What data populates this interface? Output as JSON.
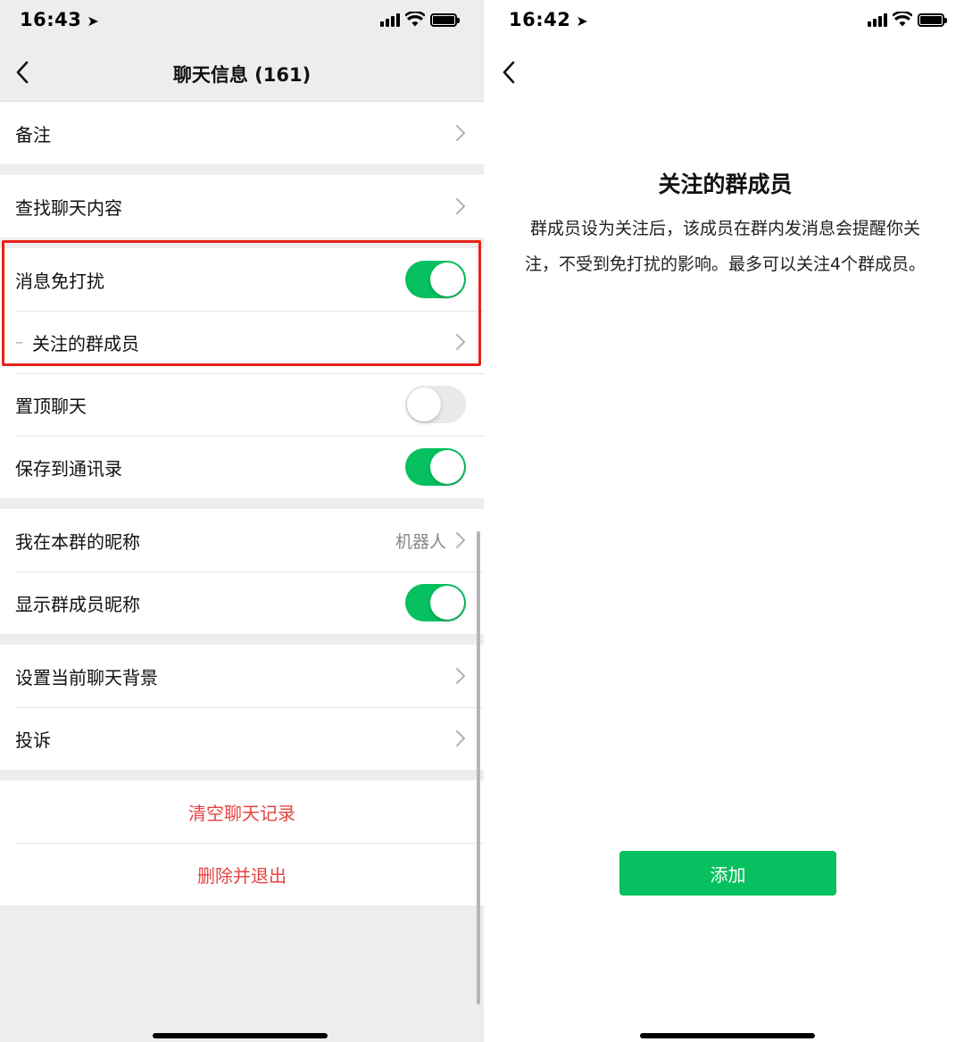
{
  "left": {
    "status_time": "16:43",
    "title": "聊天信息 (161)",
    "rows": {
      "remark": "备注",
      "search_history": "查找聊天内容",
      "mute": "消息免打扰",
      "mute_on": true,
      "focus_members_prefix": "–",
      "focus_members": "关注的群成员",
      "sticky": "置顶聊天",
      "sticky_on": false,
      "save_contacts": "保存到通讯录",
      "save_contacts_on": true,
      "nickname": "我在本群的昵称",
      "nickname_value": "机器人",
      "show_nicknames": "显示群成员昵称",
      "show_nicknames_on": true,
      "background": "设置当前聊天背景",
      "complaint": "投诉"
    },
    "actions": {
      "clear_history": "清空聊天记录",
      "delete_exit": "删除并退出"
    }
  },
  "right": {
    "status_time": "16:42",
    "heading": "关注的群成员",
    "description": "群成员设为关注后，该成员在群内发消息会提醒你关注，不受到免打扰的影响。最多可以关注4个群成员。",
    "add_button": "添加"
  },
  "colors": {
    "accent_green": "#07c160",
    "danger_red": "#e64340",
    "highlight_red": "#e8221a"
  },
  "icons": [
    "back-chevron-icon",
    "chevron-right-icon",
    "location-arrow-icon",
    "signal-icon",
    "wifi-icon",
    "battery-icon"
  ]
}
